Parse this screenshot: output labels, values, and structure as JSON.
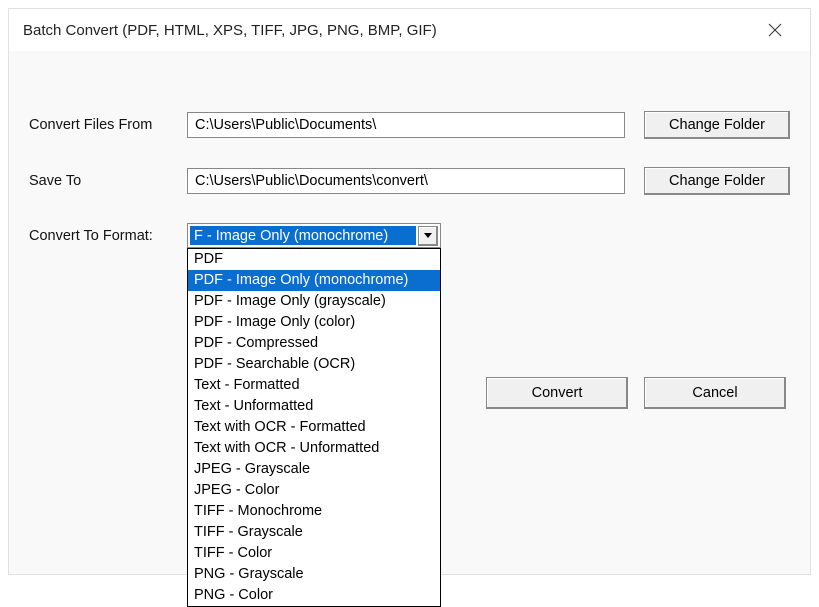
{
  "title": "Batch Convert (PDF, HTML, XPS, TIFF, JPG, PNG, BMP, GIF)",
  "labels": {
    "convert_from": "Convert Files From",
    "save_to": "Save To",
    "convert_format": "Convert To Format:"
  },
  "paths": {
    "convert_from": "C:\\Users\\Public\\Documents\\",
    "save_to": "C:\\Users\\Public\\Documents\\convert\\"
  },
  "buttons": {
    "change_folder": "Change Folder",
    "convert": "Convert",
    "cancel": "Cancel"
  },
  "format_select": {
    "display": "F - Image Only (monochrome)",
    "selected_index": 1,
    "options": [
      "PDF",
      "PDF - Image Only (monochrome)",
      "PDF - Image Only (grayscale)",
      "PDF - Image Only (color)",
      "PDF - Compressed",
      "PDF - Searchable (OCR)",
      "Text - Formatted",
      "Text - Unformatted",
      "Text with OCR - Formatted",
      "Text with OCR - Unformatted",
      "JPEG - Grayscale",
      "JPEG - Color",
      "TIFF - Monochrome",
      "TIFF - Grayscale",
      "TIFF - Color",
      "PNG - Grayscale",
      "PNG - Color"
    ]
  }
}
